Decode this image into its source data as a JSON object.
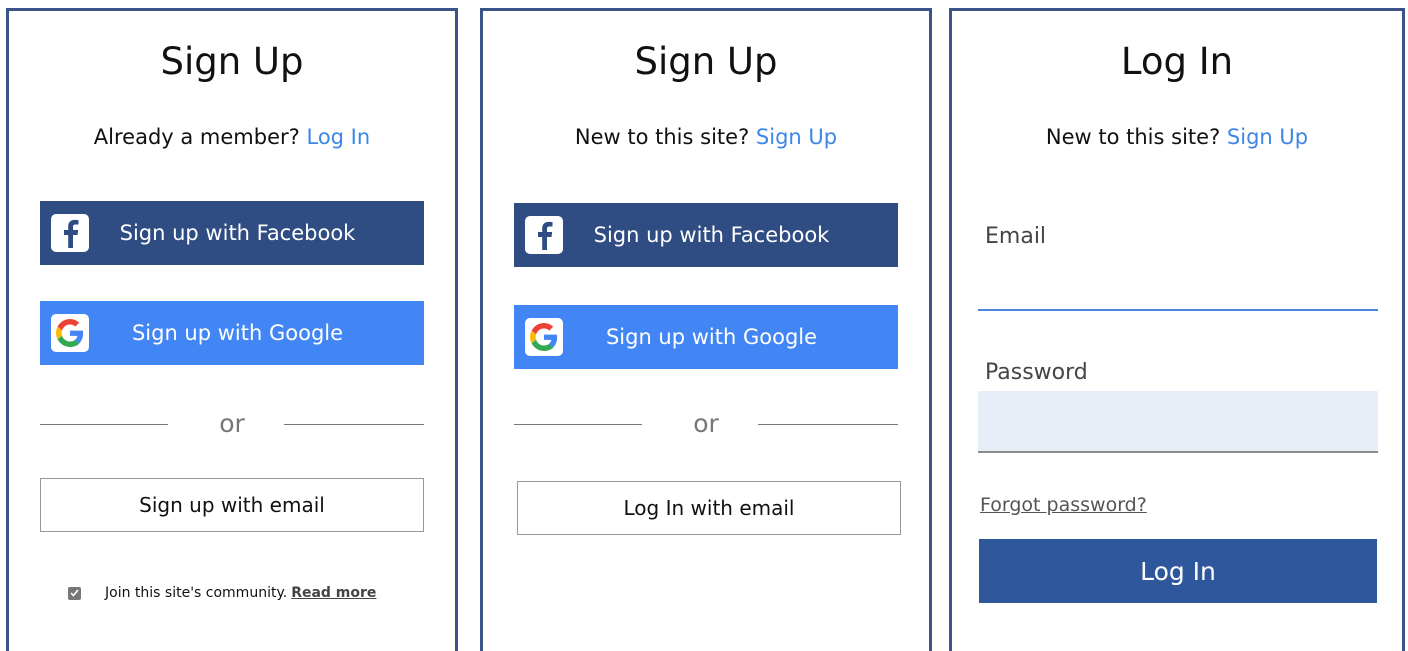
{
  "panels": [
    {
      "title": "Sign Up",
      "subtitle_text": "Already a member?",
      "subtitle_link": "Log In",
      "facebook_label": "Sign up with Facebook",
      "google_label": "Sign up with Google",
      "or_text": "or",
      "email_button_label": "Sign up with email",
      "community_text": "Join this site's community.",
      "read_more": "Read more",
      "community_checked": true
    },
    {
      "title": "Sign Up",
      "subtitle_text": "New to this site?",
      "subtitle_link": "Sign Up",
      "facebook_label": "Sign up with Facebook",
      "google_label": "Sign up with Google",
      "or_text": "or",
      "email_button_label": "Log In with email"
    },
    {
      "title": "Log In",
      "subtitle_text": "New to this site?",
      "subtitle_link": "Sign Up",
      "email_label": "Email",
      "password_label": "Password",
      "forgot_label": "Forgot password?",
      "login_button": "Log In"
    }
  ],
  "colors": {
    "panel_border": "#3a5389",
    "facebook": "#2f4c83",
    "google": "#4285f4",
    "link": "#3d86e8",
    "login_button": "#2f579b"
  }
}
